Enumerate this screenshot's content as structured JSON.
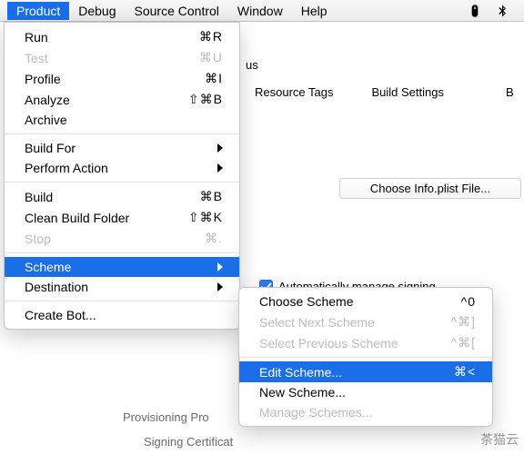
{
  "menubar": {
    "items": [
      {
        "label": "Product",
        "selected": true
      },
      {
        "label": "Debug"
      },
      {
        "label": "Source Control"
      },
      {
        "label": "Window"
      },
      {
        "label": "Help"
      }
    ]
  },
  "product_menu": {
    "run": "Run",
    "run_key": "⌘R",
    "test": "Test",
    "test_key": "⌘U",
    "profile": "Profile",
    "profile_key": "⌘I",
    "analyze": "Analyze",
    "analyze_key": "⇧⌘B",
    "archive": "Archive",
    "build_for": "Build For",
    "perform_action": "Perform Action",
    "build": "Build",
    "build_key": "⌘B",
    "clean": "Clean Build Folder",
    "clean_key": "⇧⌘K",
    "stop": "Stop",
    "stop_key": "⌘.",
    "scheme": "Scheme",
    "destination": "Destination",
    "create_bot": "Create Bot..."
  },
  "scheme_submenu": {
    "choose": "Choose Scheme",
    "choose_key": "^0",
    "select_next": "Select Next Scheme",
    "select_next_key": "^⌘]",
    "select_prev": "Select Previous Scheme",
    "select_prev_key": "^⌘[",
    "edit": "Edit Scheme...",
    "edit_key": "⌘<",
    "new": "New Scheme...",
    "manage": "Manage Schemes..."
  },
  "tabs": {
    "resource_tags": "Resource Tags",
    "build_settings": "Build Settings",
    "b": "B"
  },
  "main": {
    "us": "us",
    "choose_plist": "Choose Info.plist File...",
    "auto_manage": "Automatically manage signing",
    "provisioning": "Provisioning Pro",
    "signing_cert": "Signing Certificat"
  },
  "watermark": "茶猫云"
}
